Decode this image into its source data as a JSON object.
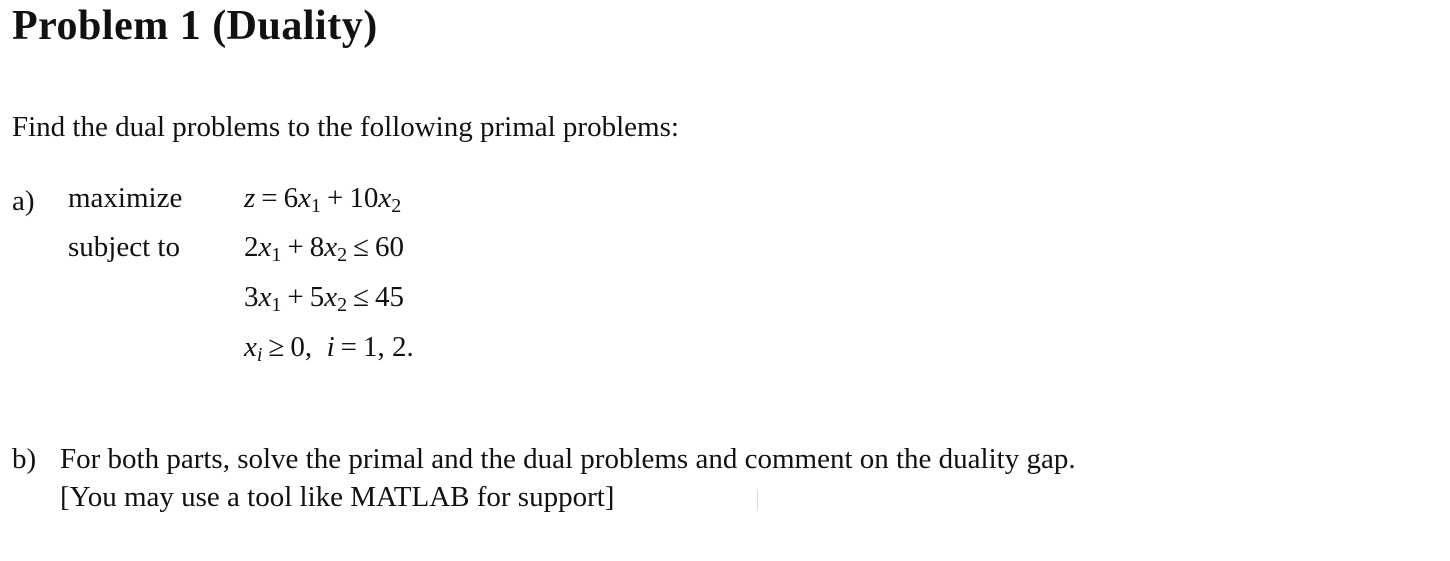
{
  "document": {
    "title": "Problem 1 (Duality)",
    "intro": "Find the dual problems to the following primal problems:",
    "part_a": {
      "label": "a)",
      "objective_keyword": "maximize",
      "constraint_keyword": "subject to",
      "objective": {
        "lhs": "z",
        "eq": "=",
        "c1": "6",
        "v1": "x",
        "s1": "1",
        "plus": "+",
        "c2": "10",
        "v2": "x",
        "s2": "2"
      },
      "constraints": [
        {
          "c1": "2",
          "v1": "x",
          "s1": "1",
          "plus": "+",
          "c2": "8",
          "v2": "x",
          "s2": "2",
          "rel": "≤",
          "rhs": "60"
        },
        {
          "c1": "3",
          "v1": "x",
          "s1": "1",
          "plus": "+",
          "c2": "5",
          "v2": "x",
          "s2": "2",
          "rel": "≤",
          "rhs": "45"
        }
      ],
      "nonnegativity": {
        "var": "x",
        "sub": "i",
        "rel": "≥",
        "val": "0,",
        "idx": "i",
        "eq": "=",
        "range": "1, 2."
      }
    },
    "part_b": {
      "label": "b)",
      "line1": "For both parts, solve the primal and the dual problems and comment on the duality gap.",
      "line2": "[You may use a tool like MATLAB for support]"
    }
  }
}
